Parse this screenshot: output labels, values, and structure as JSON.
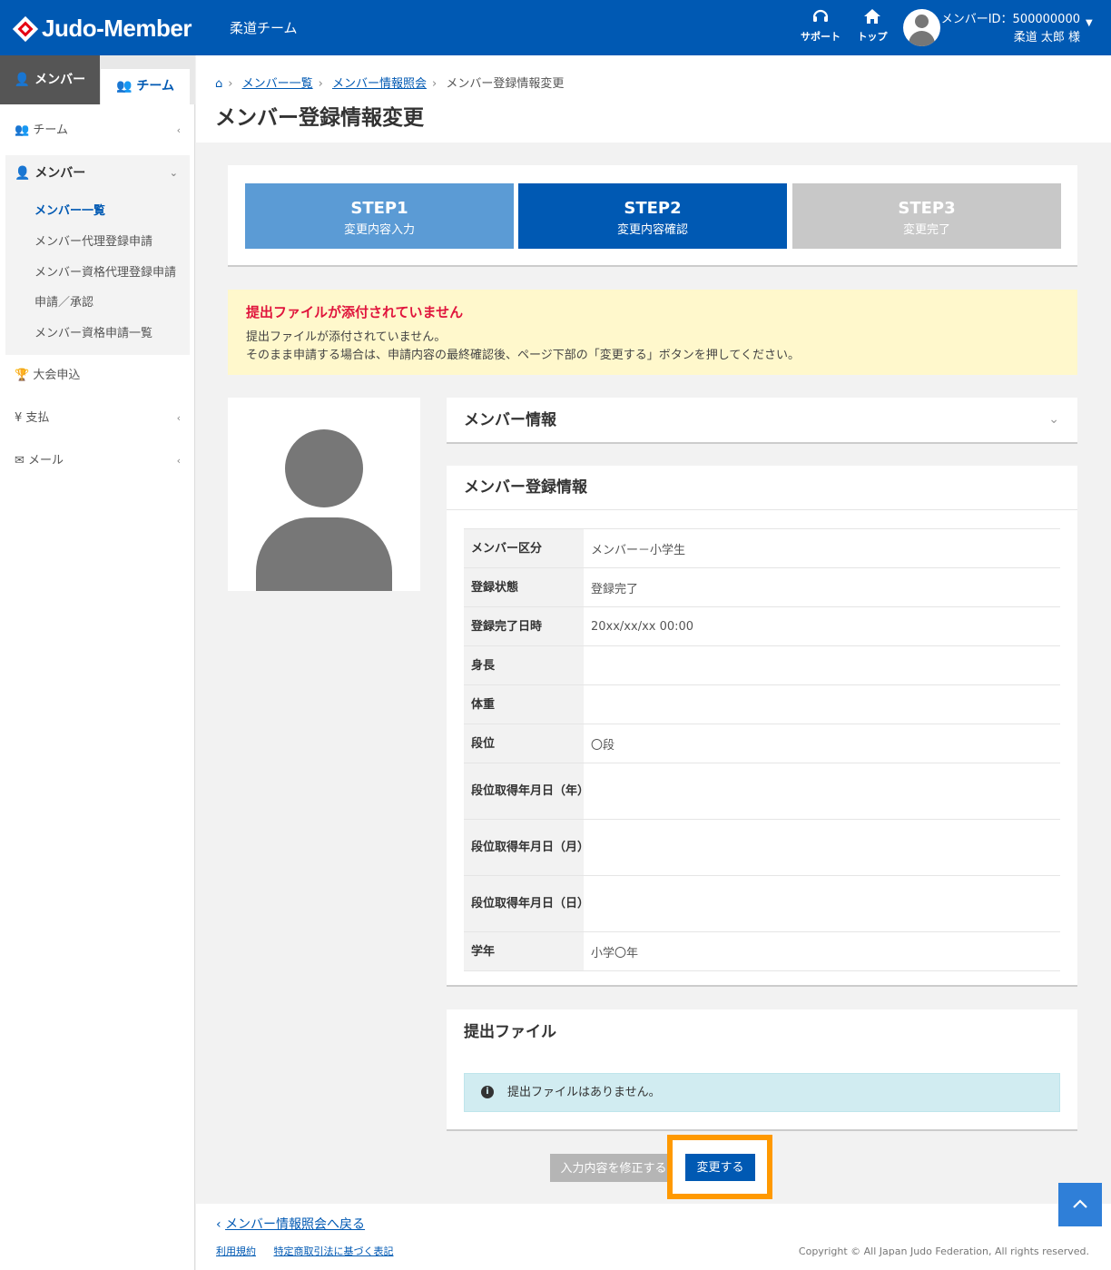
{
  "header": {
    "logo": "Judo-Member",
    "team": "柔道チーム",
    "support": "サポート",
    "top": "トップ",
    "member_id": "メンバーID：500000000",
    "user_name": "柔道 太郎 様"
  },
  "sidebar": {
    "tab_member": "メンバー",
    "tab_team": "チーム",
    "team": "チーム",
    "member": "メンバー",
    "sub": [
      "メンバー一覧",
      "メンバー代理登録申請",
      "メンバー資格代理登録申請",
      "申請／承認",
      "メンバー資格申請一覧"
    ],
    "tournament": "大会申込",
    "payment": "支払",
    "mail": "メール"
  },
  "breadcrumb": [
    "メンバー一覧",
    "メンバー情報照会",
    "メンバー登録情報変更"
  ],
  "page_title": "メンバー登録情報変更",
  "steps": [
    {
      "title": "STEP1",
      "sub": "変更内容入力"
    },
    {
      "title": "STEP2",
      "sub": "変更内容確認"
    },
    {
      "title": "STEP3",
      "sub": "変更完了"
    }
  ],
  "alert": {
    "title": "提出ファイルが添付されていません",
    "line1": "提出ファイルが添付されていません。",
    "line2": "そのまま申請する場合は、申請内容の最終確認後、ページ下部の「変更する」ボタンを押してください。"
  },
  "member_info_title": "メンバー情報",
  "registration": {
    "title": "メンバー登録情報",
    "rows": [
      {
        "k": "メンバー区分",
        "v": "メンバー－小学生"
      },
      {
        "k": "登録状態",
        "v": "登録完了"
      },
      {
        "k": "登録完了日時",
        "v": "20xx/xx/xx 00:00"
      },
      {
        "k": "身長",
        "v": ""
      },
      {
        "k": "体重",
        "v": ""
      },
      {
        "k": "段位",
        "v": "〇段"
      },
      {
        "k": "段位取得年月日（年）",
        "v": ""
      },
      {
        "k": "段位取得年月日（月）",
        "v": ""
      },
      {
        "k": "段位取得年月日（日）",
        "v": ""
      },
      {
        "k": "学年",
        "v": "小学〇年"
      }
    ]
  },
  "files": {
    "title": "提出ファイル",
    "none": "提出ファイルはありません。"
  },
  "buttons": {
    "back": "入力内容を修正する",
    "submit": "変更する"
  },
  "footer": {
    "back_link": "メンバー情報照会へ戻る",
    "terms": "利用規約",
    "law": "特定商取引法に基づく表記",
    "copyright": "Copyright © All Japan Judo Federation, All rights reserved."
  }
}
